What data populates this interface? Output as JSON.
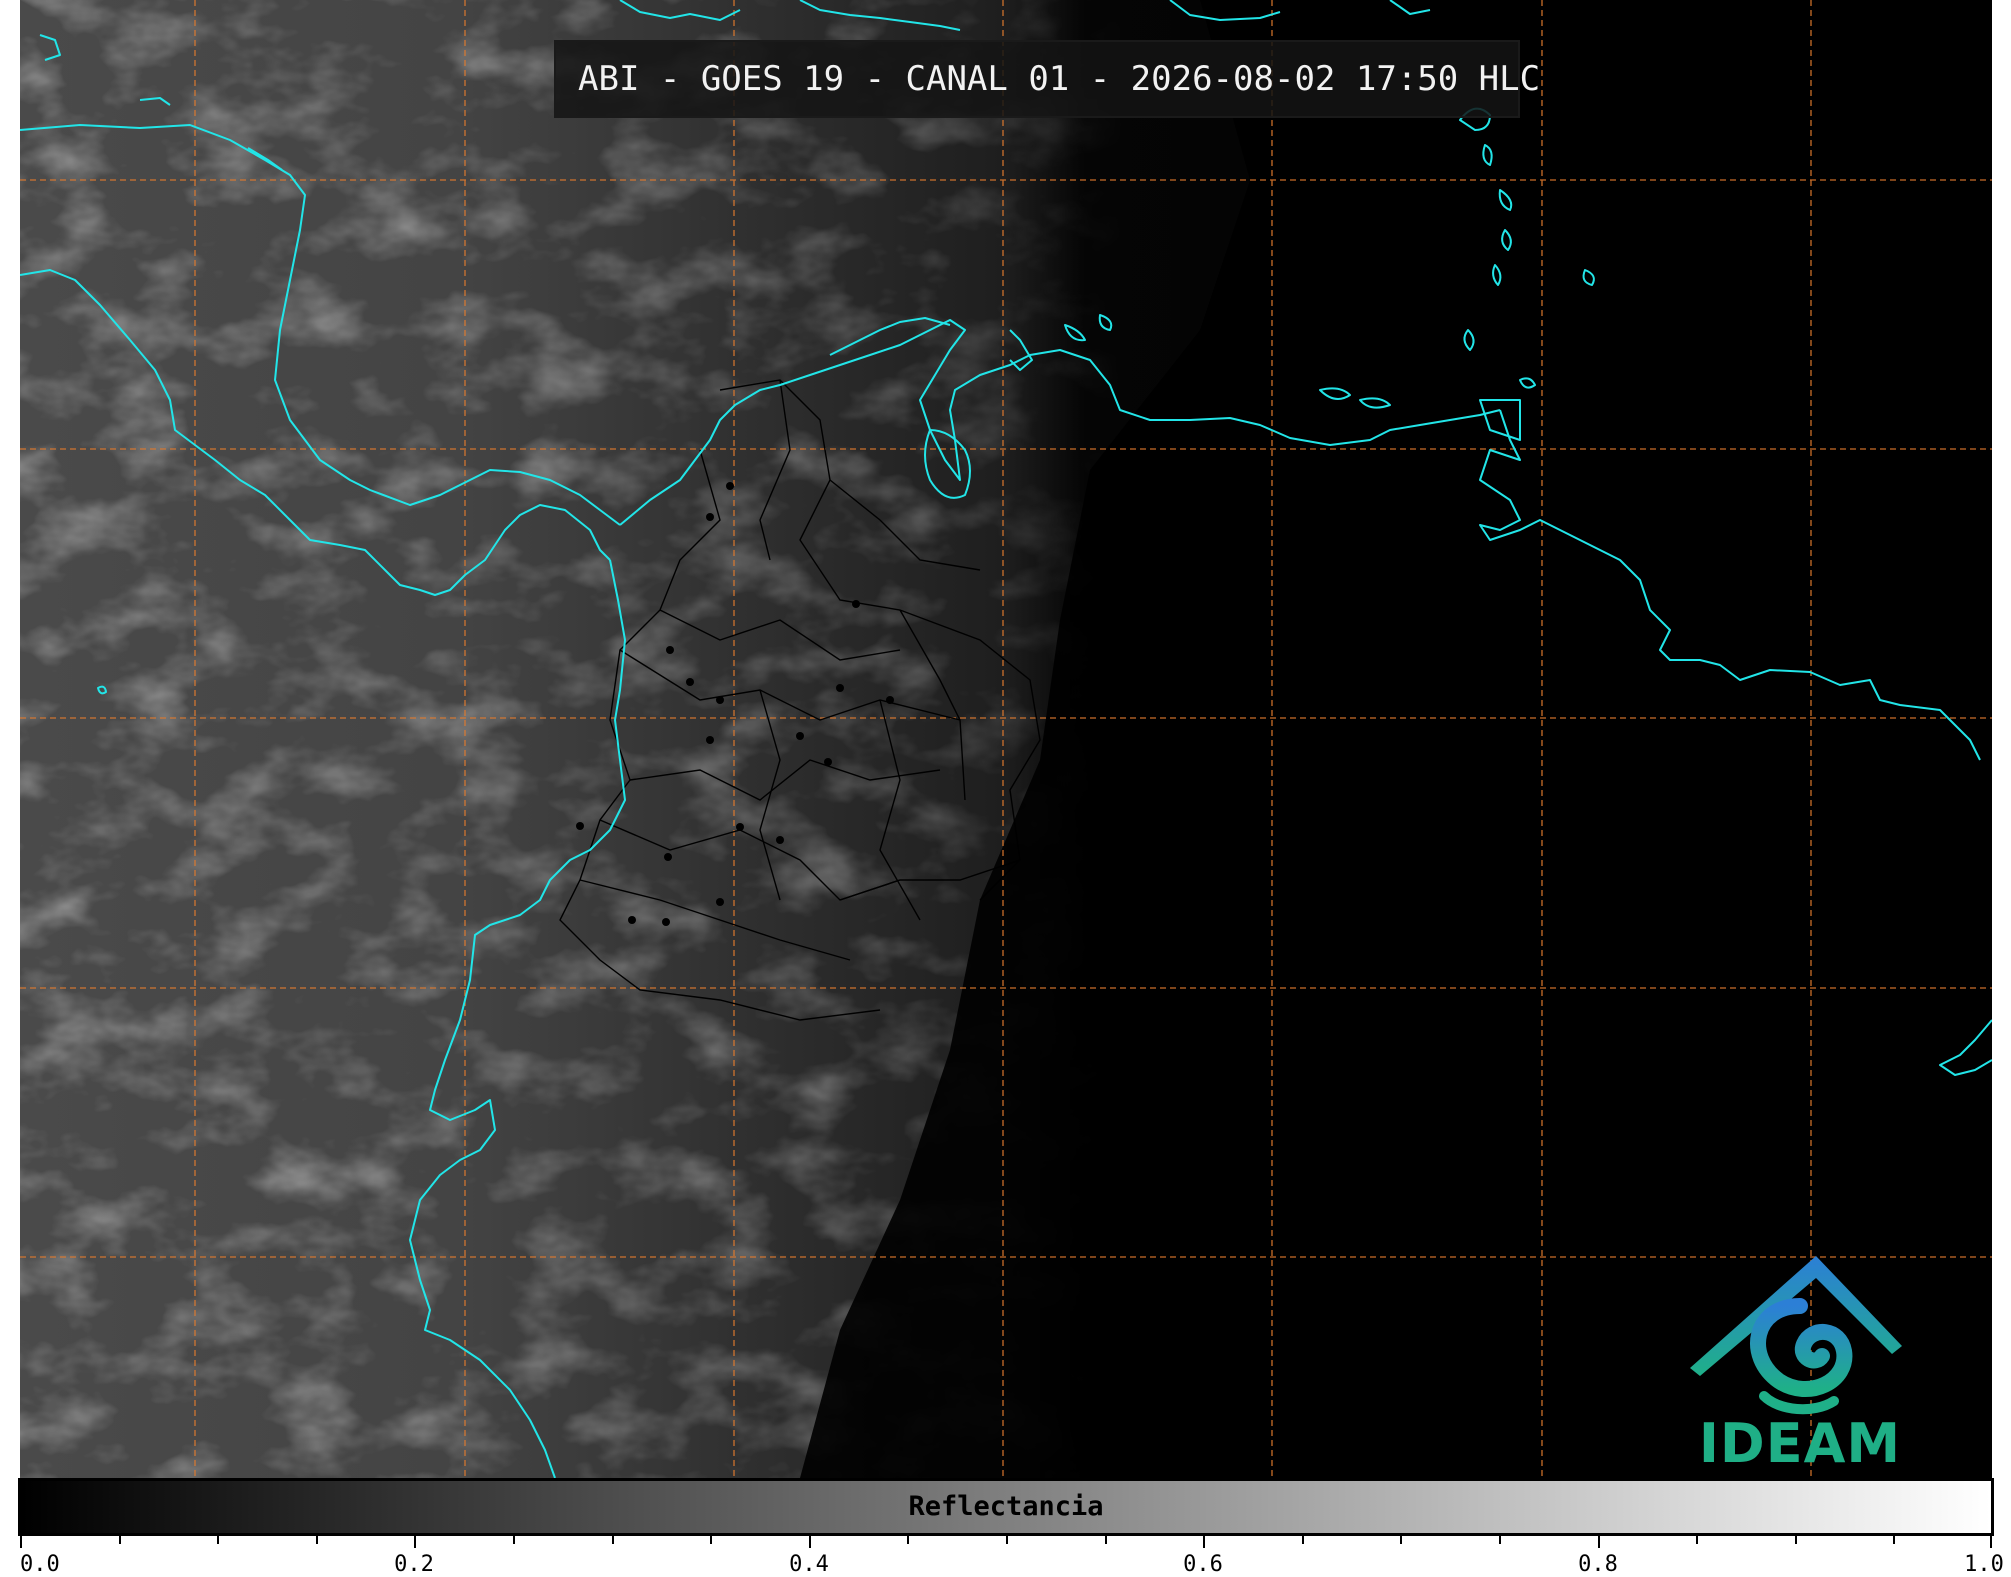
{
  "title": "ABI - GOES 19 - CANAL 01 - 2026-08-02 17:50 HLC",
  "logo": {
    "text": "IDEAM",
    "icon": "ideam-mountain-swirl-logo"
  },
  "colorbar": {
    "label": "Reflectancia",
    "min": 0.0,
    "max": 1.0,
    "ticks": [
      "0.0",
      "0.2",
      "0.4",
      "0.6",
      "0.8",
      "1.0"
    ],
    "color_start": "#000000",
    "color_end": "#ffffff"
  },
  "colors": {
    "coastline": "#22e5e8",
    "gridline": "#e07a2e",
    "borders": "#000000"
  }
}
